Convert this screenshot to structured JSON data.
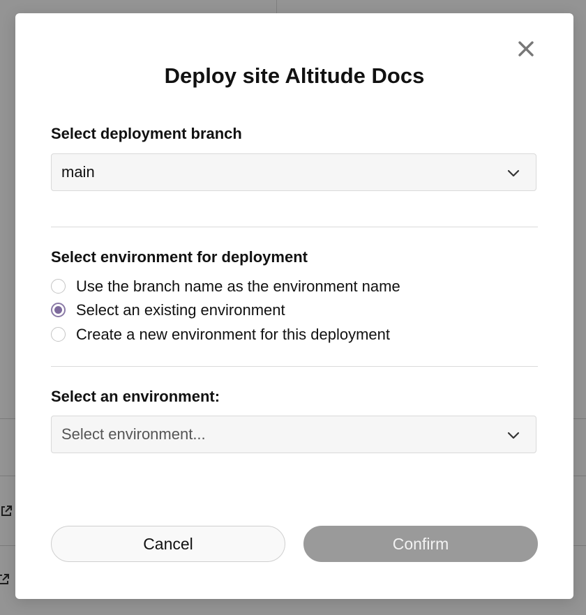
{
  "modal": {
    "title": "Deploy site Altitude Docs",
    "close_icon": "close-icon"
  },
  "branch": {
    "label": "Select deployment branch",
    "value": "main",
    "icon": "chevron-down-icon"
  },
  "environment_mode": {
    "label": "Select environment for deployment",
    "options": [
      {
        "label": "Use the branch name as the environment name",
        "checked": false
      },
      {
        "label": "Select an existing environment",
        "checked": true
      },
      {
        "label": "Create a new environment for this deployment",
        "checked": false
      }
    ]
  },
  "environment": {
    "label": "Select an environment:",
    "placeholder": "Select environment...",
    "icon": "chevron-down-icon"
  },
  "actions": {
    "cancel_label": "Cancel",
    "confirm_label": "Confirm"
  },
  "colors": {
    "accent": "#7d6a9c",
    "confirm_disabled_bg": "#9a9a9a"
  }
}
